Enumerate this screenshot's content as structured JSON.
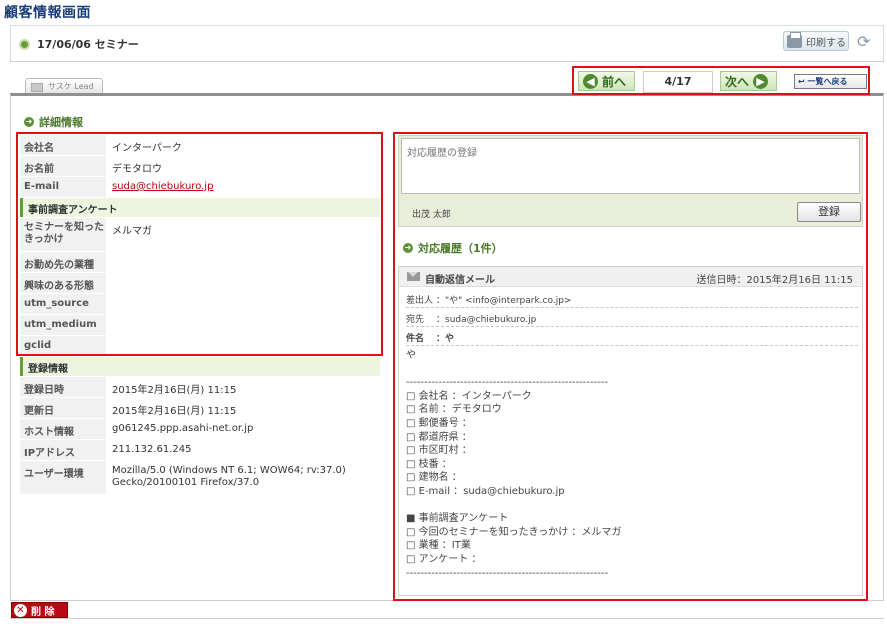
{
  "page_title": "顧客情報画面",
  "event": {
    "title": "17/06/06 セミナー"
  },
  "toolbar": {
    "print_label": "印刷する",
    "print_icon": "printer-icon",
    "refresh_icon": "refresh-icon"
  },
  "source_tab": {
    "label": "サスケ Lead"
  },
  "navigation": {
    "prev_label": "前へ",
    "next_label": "次へ",
    "page_indicator": "4/17",
    "back_label": "一覧へ戻る"
  },
  "details": {
    "heading": "詳細情報",
    "fields": [
      {
        "label": "会社名",
        "value": "インターパーク"
      },
      {
        "label": "お名前",
        "value": "デモタロウ"
      },
      {
        "label": "E-mail",
        "value": "suda@chiebukuro.jp"
      }
    ],
    "survey_group": "事前調査アンケート",
    "survey": [
      {
        "label_line1": "セミナーを知った",
        "label_line2": "きっかけ",
        "value": "メルマガ"
      },
      {
        "label": "お勤め先の業種",
        "value": ""
      },
      {
        "label": "興味のある形態",
        "value": ""
      },
      {
        "label": "utm_source",
        "value": ""
      },
      {
        "label": "utm_medium",
        "value": ""
      },
      {
        "label": "gclid",
        "value": ""
      }
    ],
    "registration_group": "登録情報",
    "registration": [
      {
        "label": "登録日時",
        "value": "2015年2月16日(月) 11:15"
      },
      {
        "label": "更新日",
        "value": "2015年2月16日(月) 11:15"
      },
      {
        "label": "ホスト情報",
        "value": "g061245.ppp.asahi-net.or.jp"
      },
      {
        "label": "IPアドレス",
        "value": "211.132.61.245"
      },
      {
        "label": "ユーザー環境",
        "value_line1": "Mozilla/5.0 (Windows NT 6.1; WOW64; rv:37.0)",
        "value_line2": "Gecko/20100101 Firefox/37.0"
      }
    ]
  },
  "history_form": {
    "placeholder": "対応履歴の登録",
    "staff": "出茂 太郎",
    "submit_label": "登録"
  },
  "history": {
    "heading": "対応履歴（1件）",
    "mail": {
      "type": "自動返信メール",
      "sent_at": "送信日時：2015年2月16日 11:15",
      "from_label": "差出人",
      "from_value": "：\"や\" <info@interpark.co.jp>",
      "to_label": "宛先",
      "to_value": "：suda@chiebukuro.jp",
      "subject_label": "件名",
      "subject_value": "：や",
      "body": "や\n\n--------------------------------------------------------\n□ 会社名 ：インターパーク\n□ 名前 ：デモタロウ\n□ 郵便番号 ：\n□ 都道府県 ：\n□ 市区町村 ：\n□ 枝番 ：\n□ 建物名 ：\n□ E-mail ：suda@chiebukuro.jp\n\n■ 事前調査アンケート\n□ 今回のセミナーを知ったきっかけ ：メルマガ\n□ 業種 ：IT業\n□ アンケート ：\n--------------------------------------------------------"
    }
  },
  "actions": {
    "delete_label": "削 除"
  },
  "colors": {
    "highlight": "#e0101b",
    "accent_green": "#4a7a2a",
    "title_blue": "#1a3d7c",
    "delete_red": "#b80a14"
  }
}
